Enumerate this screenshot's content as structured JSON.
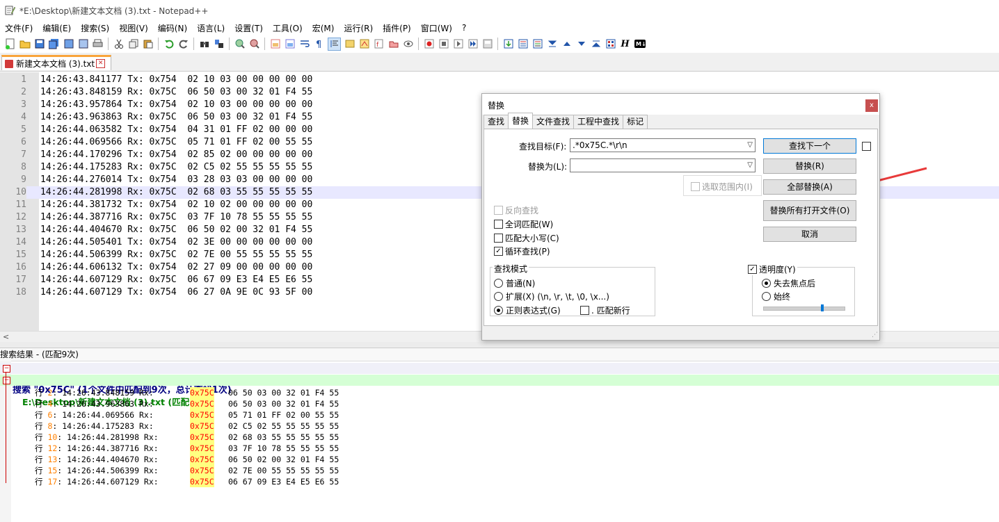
{
  "window": {
    "title": "*E:\\Desktop\\新建文本文档 (3).txt - Notepad++"
  },
  "menu": [
    "文件(F)",
    "编辑(E)",
    "搜索(S)",
    "视图(V)",
    "编码(N)",
    "语言(L)",
    "设置(T)",
    "工具(O)",
    "宏(M)",
    "运行(R)",
    "插件(P)",
    "窗口(W)",
    "?"
  ],
  "tab": {
    "name": "新建文本文档 (3).txt",
    "close": "✕"
  },
  "editor": {
    "current_line": 10,
    "lines": [
      {
        "n": "1",
        "text": "14:26:43.841177 Tx: 0x754  02 10 03 00 00 00 00 00"
      },
      {
        "n": "2",
        "text": "14:26:43.848159 Rx: 0x75C  06 50 03 00 32 01 F4 55"
      },
      {
        "n": "3",
        "text": "14:26:43.957864 Tx: 0x754  02 10 03 00 00 00 00 00"
      },
      {
        "n": "4",
        "text": "14:26:43.963863 Rx: 0x75C  06 50 03 00 32 01 F4 55"
      },
      {
        "n": "5",
        "text": "14:26:44.063582 Tx: 0x754  04 31 01 FF 02 00 00 00"
      },
      {
        "n": "6",
        "text": "14:26:44.069566 Rx: 0x75C  05 71 01 FF 02 00 55 55"
      },
      {
        "n": "7",
        "text": "14:26:44.170296 Tx: 0x754  02 85 02 00 00 00 00 00"
      },
      {
        "n": "8",
        "text": "14:26:44.175283 Rx: 0x75C  02 C5 02 55 55 55 55 55"
      },
      {
        "n": "9",
        "text": "14:26:44.276014 Tx: 0x754  03 28 03 03 00 00 00 00"
      },
      {
        "n": "10",
        "text": "14:26:44.281998 Rx: 0x75C  02 68 03 55 55 55 55 55"
      },
      {
        "n": "11",
        "text": "14:26:44.381732 Tx: 0x754  02 10 02 00 00 00 00 00"
      },
      {
        "n": "12",
        "text": "14:26:44.387716 Rx: 0x75C  03 7F 10 78 55 55 55 55"
      },
      {
        "n": "13",
        "text": "14:26:44.404670 Rx: 0x75C  06 50 02 00 32 01 F4 55"
      },
      {
        "n": "14",
        "text": "14:26:44.505401 Tx: 0x754  02 3E 00 00 00 00 00 00"
      },
      {
        "n": "15",
        "text": "14:26:44.506399 Rx: 0x75C  02 7E 00 55 55 55 55 55"
      },
      {
        "n": "16",
        "text": "14:26:44.606132 Tx: 0x754  02 27 09 00 00 00 00 00"
      },
      {
        "n": "17",
        "text": "14:26:44.607129 Rx: 0x75C  06 67 09 E3 E4 E5 E6 55"
      },
      {
        "n": "18",
        "text": "14:26:44.607129 Tx: 0x754  06 27 0A 9E 0C 93 5F 00"
      }
    ]
  },
  "results": {
    "header": "搜索结果 - (匹配9次)",
    "search_line": "搜索 \"0x75C\" (1个文件中匹配到9次，总计查找1次)",
    "file_line": "E:\\Desktop\\新建文本文档 (3).txt (匹配9次)",
    "row_prefix": "行",
    "hit": "0x75C",
    "rows": [
      {
        "n": "2",
        "pre": ": 14:26:43.848159 Rx: ",
        "post": "06 50 03 00 32 01 F4 55"
      },
      {
        "n": "4",
        "pre": ": 14:26:43.963863 Rx: ",
        "post": "06 50 03 00 32 01 F4 55"
      },
      {
        "n": "6",
        "pre": ": 14:26:44.069566 Rx: ",
        "post": "05 71 01 FF 02 00 55 55"
      },
      {
        "n": "8",
        "pre": ": 14:26:44.175283 Rx: ",
        "post": "02 C5 02 55 55 55 55 55"
      },
      {
        "n": "10",
        "pre": ": 14:26:44.281998 Rx: ",
        "post": "02 68 03 55 55 55 55 55"
      },
      {
        "n": "12",
        "pre": ": 14:26:44.387716 Rx: ",
        "post": "03 7F 10 78 55 55 55 55"
      },
      {
        "n": "13",
        "pre": ": 14:26:44.404670 Rx: ",
        "post": "06 50 02 00 32 01 F4 55"
      },
      {
        "n": "15",
        "pre": ": 14:26:44.506399 Rx: ",
        "post": "02 7E 00 55 55 55 55 55"
      },
      {
        "n": "17",
        "pre": ": 14:26:44.607129 Rx: ",
        "post": "06 67 09 E3 E4 E5 E6 55"
      }
    ]
  },
  "dialog": {
    "title": "替换",
    "close": "x",
    "tabs": [
      "查找",
      "替换",
      "文件查找",
      "工程中查找",
      "标记"
    ],
    "active_tab": 1,
    "find_label": "查找目标(F):",
    "find_value": ".*0x75C.*\\r\\n",
    "replace_label": "替换为(L):",
    "replace_value": "",
    "btn_find_next": "查找下一个",
    "btn_replace": "替换(R)",
    "btn_replace_all": "全部替换(A)",
    "btn_replace_all_open": "替换所有打开文件(O)",
    "btn_cancel": "取消",
    "in_selection": "选取范围内(I)",
    "opt_backward": "反向查找",
    "opt_whole_word": "全词匹配(W)",
    "opt_match_case": "匹配大小写(C)",
    "opt_wrap": "循环查找(P)",
    "mode_title": "查找模式",
    "mode_normal": "普通(N)",
    "mode_extended": "扩展(X) (\\n, \\r, \\t, \\0, \\x...)",
    "mode_regex": "正则表达式(G)",
    "dot_newline": ". 匹配新行",
    "transparency": "透明度(Y)",
    "trans_on_lose": "失去焦点后",
    "trans_always": "始终",
    "check_mark": "✓"
  },
  "colors": {
    "accent_blue": "#0078d7",
    "hit_red": "#ff0000",
    "line_num_orange": "#ff8000",
    "arrow_red": "#e83a3a"
  }
}
